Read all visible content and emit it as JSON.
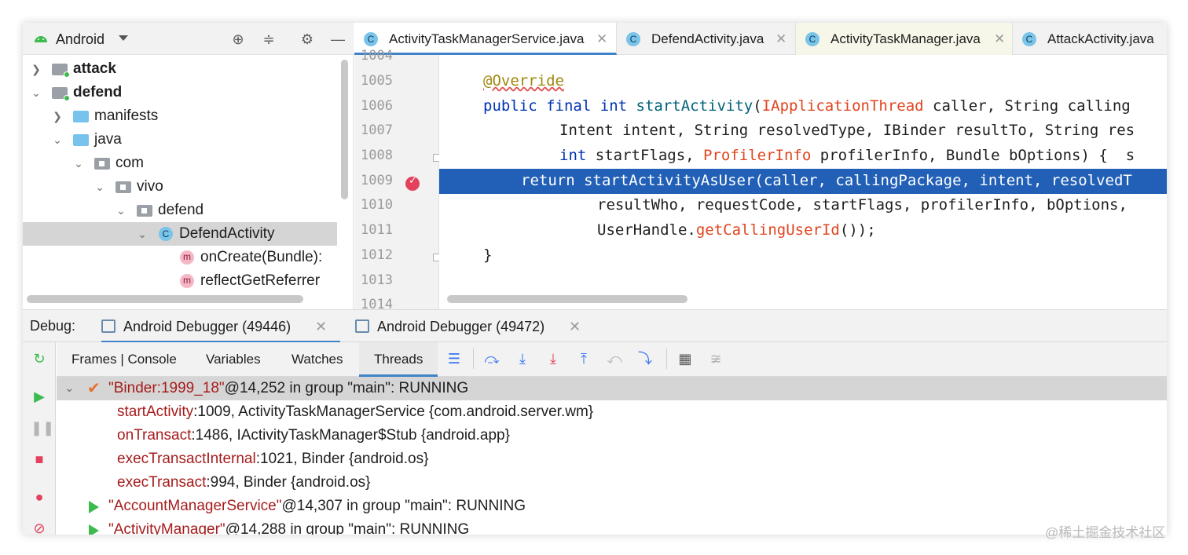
{
  "project": {
    "title": "Android",
    "tree": [
      {
        "label": "attack",
        "bold": true
      },
      {
        "label": "defend",
        "bold": true
      },
      {
        "label": "manifests"
      },
      {
        "label": "java"
      },
      {
        "label": "com"
      },
      {
        "label": "vivo"
      },
      {
        "label": "defend"
      },
      {
        "label": "DefendActivity",
        "selected": true
      },
      {
        "label": "onCreate(Bundle):"
      },
      {
        "label": "reflectGetReferrer"
      }
    ]
  },
  "editor": {
    "tabs": [
      {
        "label": "ActivityTaskManagerService.java",
        "active": true
      },
      {
        "label": "DefendActivity.java"
      },
      {
        "label": "ActivityTaskManager.java"
      },
      {
        "label": "AttackActivity.java"
      }
    ],
    "line_numbers": [
      "1004",
      "1005",
      "1006",
      "1007",
      "1008",
      "1009",
      "1010",
      "1011",
      "1012",
      "1013",
      "1014"
    ],
    "code": {
      "l1005": "@Override",
      "l1006": [
        "public",
        "final",
        "int",
        "startActivity",
        "(",
        "IApplicationThread",
        " caller, String calling"
      ],
      "l1007": "Intent intent, String resolvedType, IBinder resultTo, String res",
      "l1008": [
        "int",
        " startFlags, ",
        "ProfilerInfo",
        " profilerInfo, Bundle bOptions) {  s"
      ],
      "l1009": "return startActivityAsUser(caller, callingPackage, intent, resolvedT",
      "l1010": "resultWho, requestCode, startFlags, profilerInfo, bOptions,",
      "l1011": [
        "UserHandle.",
        "getCallingUserId",
        "());"
      ],
      "l1012": "}"
    }
  },
  "debug": {
    "label": "Debug:",
    "sessions": [
      {
        "label": "Android Debugger (49446)",
        "active": true
      },
      {
        "label": "Android Debugger (49472)"
      }
    ],
    "subtabs": [
      "Frames | Console",
      "Variables",
      "Watches",
      "Threads"
    ],
    "threads": [
      {
        "name": "\"Binder:1999_18\"",
        "rest": "@14,252 in group \"main\": RUNNING",
        "selected": true
      },
      {
        "frame": "startActivity",
        "rest": ":1009, ActivityTaskManagerService {com.android.server.wm}"
      },
      {
        "frame": "onTransact",
        "rest": ":1486, IActivityTaskManager$Stub {android.app}"
      },
      {
        "frame": "execTransactInternal",
        "rest": ":1021, Binder {android.os}"
      },
      {
        "frame": "execTransact",
        "rest": ":994, Binder {android.os}"
      },
      {
        "name": "\"AccountManagerService\"",
        "rest": "@14,307 in group \"main\": RUNNING"
      },
      {
        "name": "\"ActivityManager\"",
        "rest": "@14,288 in group \"main\": RUNNING"
      }
    ]
  },
  "watermark": "@稀土掘金技术社区",
  "colors": {
    "accent": "#4083c9",
    "highlight": "#2260b7",
    "thread_name": "#a61c1c",
    "run": "#3dbb4f",
    "breakpoint": "#e3415c"
  }
}
